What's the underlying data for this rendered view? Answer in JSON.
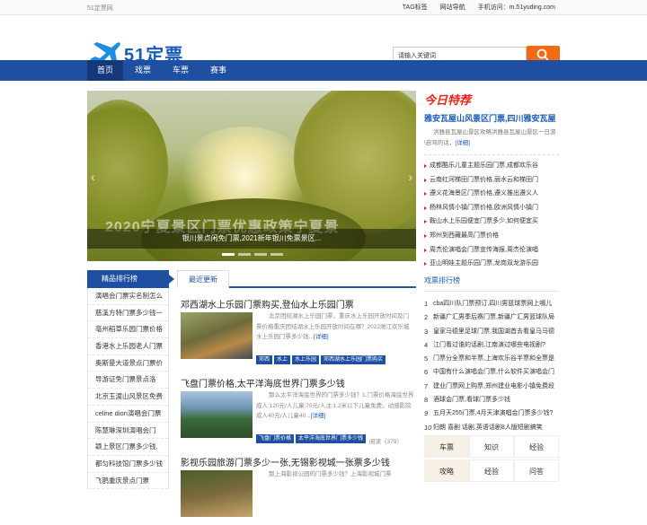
{
  "topbar": {
    "site": "51定票网",
    "links": [
      "TAG标签",
      "网站导航",
      "手机访问：m.51yuding.com"
    ]
  },
  "logo": {
    "text": "51定票"
  },
  "search": {
    "placeholder": "请输入关键词"
  },
  "nav": [
    "首页",
    "戏票",
    "车票",
    "赛事"
  ],
  "banner": {
    "big_text": "2020宁夏景区门票优惠政策宁夏景",
    "caption": "银川景点闲免门票,2021新年银川免票景区..."
  },
  "today": {
    "title": "今日特荐",
    "headline": "雅安瓦屋山风景区门票,四川雅安瓦屋",
    "desc": "洪雅县瓦屋山景区攻略洪雅县瓦屋山景区一日游\\自驾的话，",
    "more": "[详细]",
    "list": [
      "成都酷乐儿童主题乐园门票,成都欢乐谷",
      "云南红河梯田门票价格,丽水云和梯田门",
      "遵义花海景区门票价格,遵义推出遵义人",
      "杨林风情小镇门票价格,欧洲风情小镇门",
      "鞍山水上乐园便宜门票多少,如何便宜买",
      "郑州到西藏最高门票价格",
      "周杰伦演唱会门票宣传海报,周杰伦演唱",
      "亚山明娃主题乐园门票,龙岗双龙游乐园"
    ]
  },
  "sidebar": {
    "title": "精品排行榜",
    "items": [
      "演唱会门票实名制怎么",
      "慈溪方特门票多少钱一",
      "亳州稻草乐园门票价格",
      "香港水上乐园老人门票",
      "奥斯曼大道景点门票价",
      "导游证免门票景点洛",
      "北京玉渡山风景区免费",
      "celine dion演唱会门票",
      "陈慧琳深圳演唱会门",
      "颖上景区门票多少钱,",
      "都匀科技馆门票多少钱",
      "飞鹊重庆景点门票"
    ]
  },
  "main": {
    "tab": "最近更新",
    "articles": [
      {
        "title": "邓西湖水上乐园门票购买,登仙水上乐园门票",
        "summary": "北京团结湖水上乐园门票，重庆水上乐园开放时间及门票价格重庆团结湖水上乐园开放时间在哪？2022潍江欢乐城水上乐园门票多少钱...",
        "more": "[详细]",
        "tags": [
          "邓西",
          "水上",
          "水上乐园",
          "邓西湖水上乐园门票购买"
        ],
        "views": ""
      },
      {
        "title": "飞盘门票价格,太平洋海底世界门票多少钱",
        "summary": "那么太平洋海底世界的门票多少钱？1.门票价格海底世界成人:120元/人儿童:70元/人注:1.2米以下儿童免费。动感影院成人40元/人儿童40...",
        "more": "[详细]",
        "tags": [
          "飞盘门票价格",
          "太平洋海底世界门票多少钱"
        ],
        "views": "阅读（379）"
      },
      {
        "title": "影视乐园旅游门票多少一张,无锡影视城一张票多少钱",
        "summary": "那上海影视公园的门票多少钱？上海影视城门票",
        "more": "",
        "tags": [],
        "views": ""
      }
    ]
  },
  "rank": {
    "title": "戏票排行榜",
    "items": [
      "cba四川队门票预订,四川男篮球票网上哪儿",
      "新疆广汇男季后赛门票,新疆广汇男篮球队局",
      "皇家马德里足球门票,我国湖首去看皇马马德",
      "江门看过谁的话剧,江南演过哪些电视剧?",
      "门票分全票和半票,上海欢乐谷半票和全票是",
      "中国有什么演唱会门票,什么软件买演唱会门",
      "建业门票网上购票,郑州建业电影小镇免费段",
      "酒球会门票,看球门票多少钱",
      "五月天255门票,4月天津演唱会门票多少钱?",
      "妇朗 喜剧 话剧,英语话剧8人版短剧搞笑"
    ]
  },
  "cats": [
    "车票",
    "知识",
    "经验",
    "攻略",
    "经验",
    "问答"
  ],
  "colors": {
    "brand": "#1e4fa1",
    "accent": "#f26a13",
    "red": "#e8221c"
  }
}
